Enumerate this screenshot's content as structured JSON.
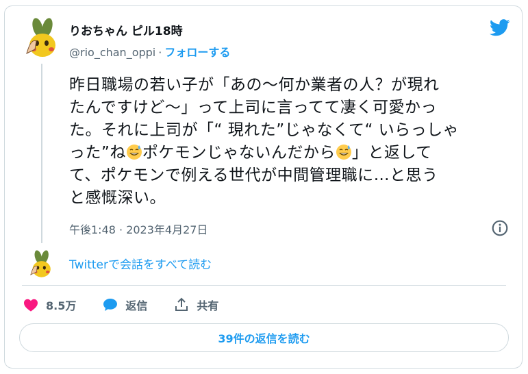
{
  "tweet": {
    "author_name": "りおちゃん ピル18時",
    "handle": "@rio_chan_oppi",
    "separator": "·",
    "follow_label": "フォローする",
    "text": "昨日職場の若い子が「あの〜何か業者の人？が現れ\nたんですけど〜」って上司に言ってて凄く可愛かっ\nた。それに上司が「“ 現れた”じゃなくて“ いらっしゃ\nった”ね",
    "text_mid": "ポケモンじゃないんだから",
    "text_end": "」と返して\nて、ポケモンで例える世代が中間管理職に…と思う\nと感慨深い。",
    "timestamp": "午後1:48 · 2023年4月27日",
    "read_conversation": "Twitterで会話をすべて読む",
    "likes_count": "8.5万",
    "reply_label": "返信",
    "share_label": "共有",
    "read_replies": "39件の返信を読む"
  },
  "colors": {
    "accent": "#1d9bf0",
    "like": "#f91880",
    "muted": "#536471",
    "border": "#cfd9de"
  },
  "icons": [
    "twitter-bird-icon",
    "info-icon",
    "heart-icon",
    "reply-bubble-icon",
    "share-icon",
    "sweat-smile-emoji"
  ]
}
